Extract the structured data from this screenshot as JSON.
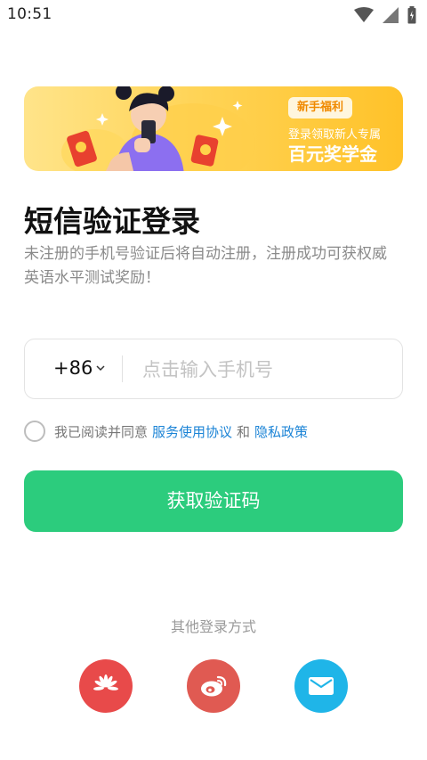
{
  "status_bar": {
    "time": "10:51"
  },
  "banner": {
    "tag": "新手福利",
    "subtitle": "登录领取新人专属",
    "headline": "百元奖学金"
  },
  "page": {
    "title": "短信验证登录",
    "description": "未注册的手机号验证后将自动注册，注册成功可获权威英语水平测试奖励！"
  },
  "phone": {
    "country_code": "+86",
    "placeholder": "点击输入手机号"
  },
  "agreement": {
    "prefix": "我已阅读并同意",
    "service_link": "服务使用协议",
    "and": "和",
    "privacy_link": "隐私政策"
  },
  "submit_label": "获取验证码",
  "other_login": {
    "title": "其他登录方式",
    "methods": [
      {
        "icon": "huawei-icon",
        "color": "#e84a4a"
      },
      {
        "icon": "weibo-icon",
        "color": "#e05a52"
      },
      {
        "icon": "email-icon",
        "color": "#1fb5e8"
      }
    ]
  }
}
